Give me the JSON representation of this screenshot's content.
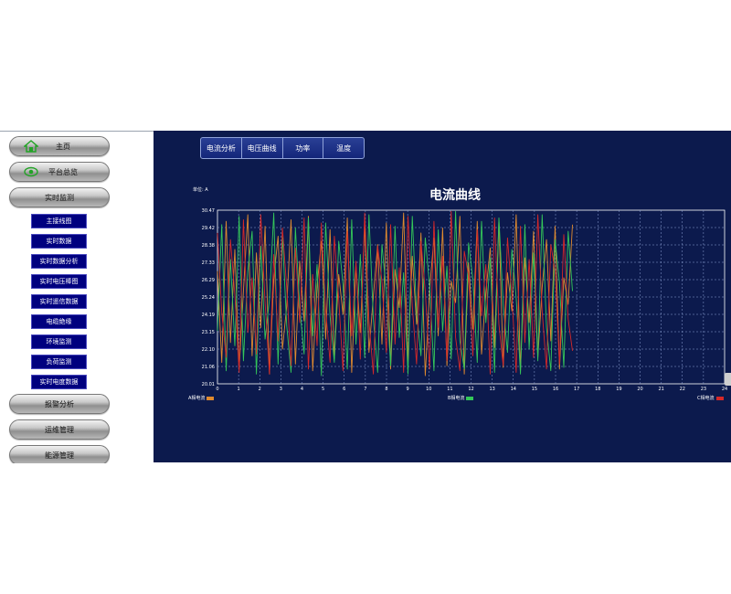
{
  "sidebar": {
    "top_items": [
      {
        "label": "主页",
        "icon": "home-icon"
      },
      {
        "label": "平台总览",
        "icon": "eye-icon"
      },
      {
        "label": "实时监测",
        "icon": ""
      }
    ],
    "sub_items": [
      "主接线图",
      "实时数据",
      "实时数据分析",
      "实时电压棒图",
      "实时遥信数据",
      "电缆绝缘",
      "环境监测",
      "负荷监测",
      "实时电度数据"
    ],
    "bottom_items": [
      "报警分析",
      "运维管理",
      "能源管理"
    ]
  },
  "tabs": [
    "电流分析",
    "电压曲线",
    "功率",
    "温度"
  ],
  "unit_label": "单位: A",
  "colors": {
    "main_bg": "#0c1a4d",
    "submenu_bg": "#00007f",
    "series_a": "#e08a2e",
    "series_b": "#34c759",
    "series_c": "#d62828"
  },
  "chart_data": {
    "type": "line",
    "title": "电流曲线",
    "y_ticks": [
      "20.01",
      "21.06",
      "22.10",
      "23.15",
      "24.19",
      "25.24",
      "26.29",
      "27.33",
      "28.38",
      "29.42",
      "30.47"
    ],
    "x_ticks": [
      "0",
      "1",
      "2",
      "3",
      "4",
      "5",
      "6",
      "7",
      "8",
      "9",
      "10",
      "11",
      "12",
      "13",
      "14",
      "15",
      "16",
      "17",
      "18",
      "19",
      "20",
      "21",
      "22",
      "23",
      "24"
    ],
    "ylim": [
      20.01,
      30.47
    ],
    "xlim": [
      0,
      24
    ],
    "grid": true,
    "legend_position": "bottom",
    "series": [
      {
        "name": "A相电流",
        "color": "#e08a2e",
        "x_end": 16.8,
        "values": [
          26.8,
          21.3,
          29.8,
          22.5,
          28.1,
          20.9,
          25.6,
          30.2,
          21.7,
          27.9,
          23.4,
          29.5,
          20.6,
          26.3,
          28.9,
          22.1,
          24.7,
          29.9,
          21.2,
          27.4,
          23.8,
          30.1,
          20.8,
          25.9,
          28.6,
          22.7,
          29.3,
          21.5,
          26.6,
          24.2,
          30.0,
          20.7,
          27.1,
          23.1,
          29.6,
          21.9,
          25.3,
          28.4,
          22.4,
          29.7,
          20.9,
          26.9,
          24.6,
          30.3,
          21.4,
          27.7,
          23.6,
          29.1,
          20.5,
          25.7,
          28.8,
          22.9,
          29.4,
          21.1,
          26.2,
          24.9,
          30.1,
          20.6,
          27.3,
          23.3,
          29.8,
          21.8,
          25.5,
          28.2,
          22.2,
          29.9,
          21.0,
          26.7,
          24.4,
          30.2,
          20.8,
          27.6,
          23.7,
          29.2,
          21.6,
          25.8,
          28.7,
          22.6,
          29.5,
          20.9,
          26.4,
          24.8,
          29.6
        ]
      },
      {
        "name": "B相电流",
        "color": "#34c759",
        "x_end": 16.8,
        "values": [
          23.2,
          29.6,
          20.8,
          27.5,
          22.3,
          30.1,
          21.4,
          26.8,
          29.2,
          20.6,
          28.3,
          22.7,
          25.1,
          30.3,
          21.2,
          28.9,
          23.5,
          20.7,
          29.4,
          24.6,
          21.8,
          30.0,
          22.9,
          27.2,
          20.5,
          29.7,
          24.1,
          21.3,
          28.6,
          26.0,
          20.9,
          29.9,
          22.4,
          27.8,
          21.6,
          30.2,
          23.9,
          20.7,
          28.4,
          25.5,
          21.1,
          29.5,
          22.8,
          26.7,
          20.6,
          30.1,
          24.3,
          21.7,
          28.8,
          25.9,
          20.8,
          29.3,
          23.2,
          27.1,
          21.5,
          30.4,
          22.6,
          20.9,
          28.5,
          26.3,
          21.3,
          29.8,
          23.7,
          27.6,
          20.7,
          30.0,
          24.8,
          21.9,
          28.1,
          25.2,
          20.6,
          29.6,
          22.1,
          27.9,
          21.4,
          30.2,
          23.4,
          20.8,
          28.7,
          26.1,
          21.0,
          29.2,
          25.6
        ]
      },
      {
        "name": "C相电流",
        "color": "#d62828",
        "x_end": 16.8,
        "values": [
          29.1,
          24.3,
          21.6,
          28.7,
          25.4,
          20.7,
          29.9,
          23.1,
          26.4,
          21.8,
          30.2,
          24.9,
          20.6,
          27.8,
          22.6,
          29.4,
          25.8,
          21.1,
          28.2,
          23.7,
          30.0,
          20.9,
          26.6,
          22.3,
          29.7,
          24.5,
          21.3,
          28.9,
          25.1,
          20.8,
          29.2,
          22.9,
          27.4,
          21.5,
          30.3,
          23.8,
          20.6,
          28.3,
          26.2,
          21.9,
          29.6,
          22.4,
          27.0,
          20.7,
          30.1,
          24.7,
          21.2,
          28.6,
          25.6,
          20.9,
          29.8,
          23.4,
          27.7,
          21.4,
          30.4,
          22.8,
          20.8,
          28.0,
          26.5,
          21.7,
          29.3,
          24.1,
          27.2,
          20.6,
          30.0,
          23.6,
          21.1,
          28.8,
          25.3,
          20.7,
          29.5,
          22.5,
          27.5,
          21.6,
          30.2,
          24.4,
          20.9,
          28.4,
          26.8,
          21.2,
          29.0,
          23.9,
          22.0
        ]
      }
    ]
  }
}
